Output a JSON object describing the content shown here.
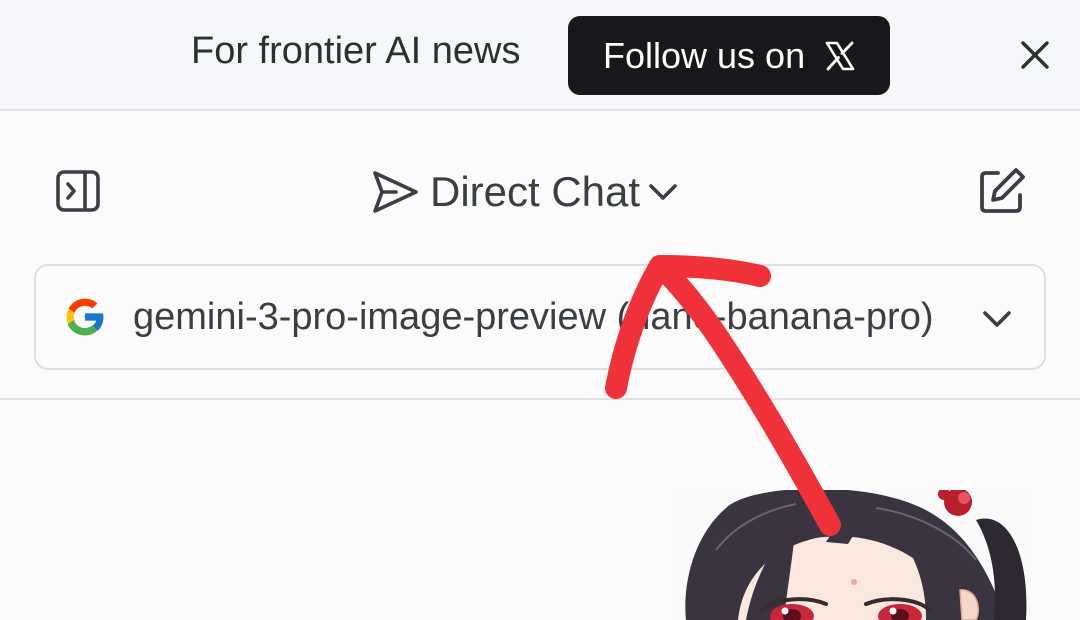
{
  "promo": {
    "text": "For frontier AI news",
    "button_label": "Follow us on",
    "button_icon": "x-logo-icon",
    "close_icon": "close-icon"
  },
  "header": {
    "sidebar_icon": "sidebar-toggle-icon",
    "mode_icon": "send-icon",
    "mode_label": "Direct Chat",
    "mode_chevron": "chevron-down-icon",
    "new_chat_icon": "edit-icon"
  },
  "model_selector": {
    "provider_icon": "google-icon",
    "model_name": "gemini-3-pro-image-preview (nano-banana-pro)",
    "chevron": "chevron-down-icon"
  },
  "chat": {
    "image": "anime-girl-image"
  },
  "colors": {
    "follow_button_bg": "#16181c",
    "annotation": "#f0313a",
    "text": "#3a3e46"
  }
}
